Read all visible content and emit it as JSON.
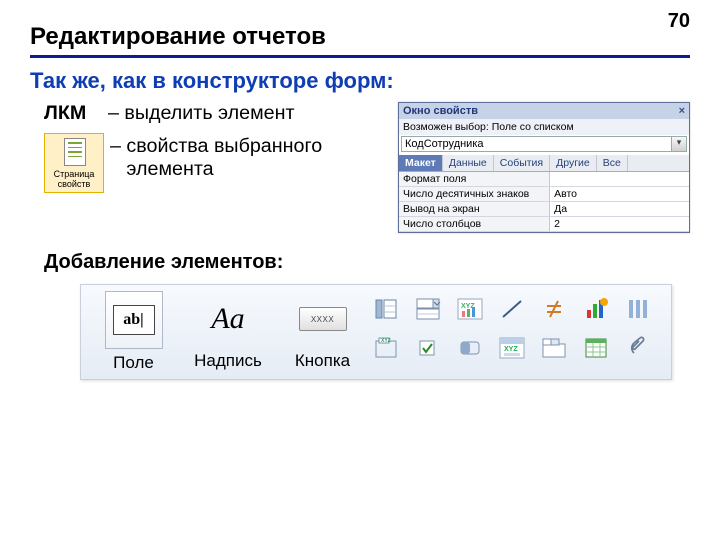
{
  "page_number": "70",
  "title": "Редактирование отчетов",
  "subhead": "Так же, как в конструкторе форм:",
  "bullets": {
    "lkm": "ЛКМ",
    "line1": "– выделить  элемент",
    "line2a": "– свойства выбранного",
    "line2b": "   элемента"
  },
  "prop_icon": {
    "label1": "Страница",
    "label2": "свойств"
  },
  "props_window": {
    "title": "Окно свойств",
    "close": "×",
    "selection_label": "Возможен выбор:  Поле со списком",
    "combo_value": "КодСотрудника",
    "tabs": [
      "Макет",
      "Данные",
      "События",
      "Другие",
      "Все"
    ],
    "active_tab": 0,
    "rows": [
      {
        "l": "Формат поля",
        "r": ""
      },
      {
        "l": "Число десятичных знаков",
        "r": "Авто"
      },
      {
        "l": "Вывод на экран",
        "r": "Да"
      },
      {
        "l": "Число столбцов",
        "r": "2"
      }
    ]
  },
  "section_add": "Добавление элементов:",
  "ribbon": {
    "big": [
      {
        "name": "field",
        "label": "Поле",
        "kind": "ab"
      },
      {
        "name": "label",
        "label": "Надпись",
        "kind": "aa"
      },
      {
        "name": "button",
        "label": "Кнопка",
        "kind": "btn",
        "btn_text": "XXXX"
      }
    ],
    "small_names": [
      "list-icon",
      "combo-icon",
      "xyz-chart-icon",
      "line-icon",
      "not-equal-icon",
      "bar-chart-icon",
      "columns-icon",
      "group-box-icon",
      "checkbox-icon",
      "toggle-icon",
      "form-xyz-icon",
      "tabs-icon",
      "spreadsheet-icon",
      "attachment-icon"
    ]
  }
}
